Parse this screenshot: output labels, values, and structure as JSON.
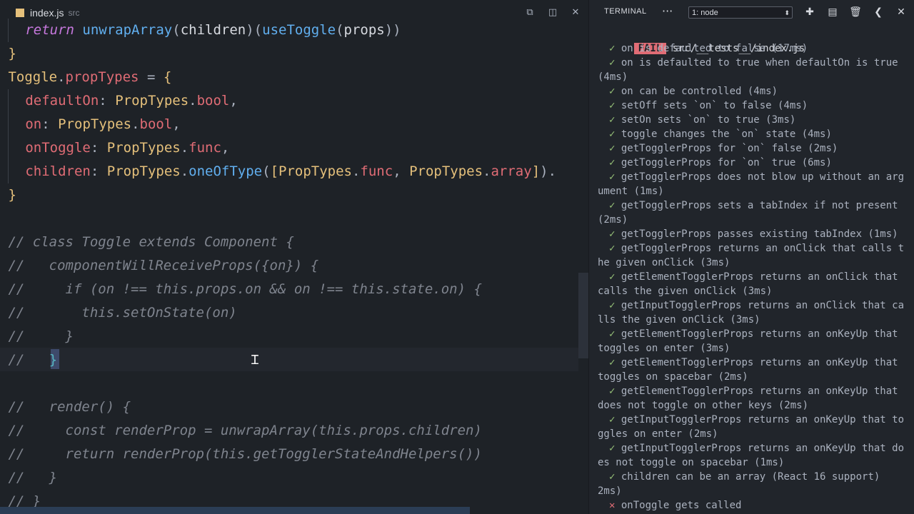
{
  "editor": {
    "tab": {
      "filename": "index.js",
      "path": "src"
    },
    "actions": [
      "open-preview",
      "split-editor",
      "close"
    ],
    "lines": [
      [
        {
          "c": "kw",
          "t": "return "
        },
        {
          "c": "fn",
          "t": "unwrapArray"
        },
        {
          "c": "pl",
          "t": "("
        },
        {
          "c": "tx",
          "t": "children"
        },
        {
          "c": "pl",
          "t": ")("
        },
        {
          "c": "fn",
          "t": "useToggle"
        },
        {
          "c": "pl",
          "t": "("
        },
        {
          "c": "tx",
          "t": "props"
        },
        {
          "c": "pl",
          "t": "))"
        }
      ],
      [
        {
          "c": "br",
          "t": "}"
        }
      ],
      [
        {
          "c": "cl",
          "t": "Toggle"
        },
        {
          "c": "pl",
          "t": "."
        },
        {
          "c": "pr",
          "t": "propTypes"
        },
        {
          "c": "pl",
          "t": " = "
        },
        {
          "c": "br",
          "t": "{"
        }
      ],
      [
        {
          "c": "pr",
          "t": "defaultOn"
        },
        {
          "c": "pl",
          "t": ": "
        },
        {
          "c": "cl",
          "t": "PropTypes"
        },
        {
          "c": "pl",
          "t": "."
        },
        {
          "c": "pr",
          "t": "bool"
        },
        {
          "c": "pl",
          "t": ","
        }
      ],
      [
        {
          "c": "pr",
          "t": "on"
        },
        {
          "c": "pl",
          "t": ": "
        },
        {
          "c": "cl",
          "t": "PropTypes"
        },
        {
          "c": "pl",
          "t": "."
        },
        {
          "c": "pr",
          "t": "bool"
        },
        {
          "c": "pl",
          "t": ","
        }
      ],
      [
        {
          "c": "pr",
          "t": "onToggle"
        },
        {
          "c": "pl",
          "t": ": "
        },
        {
          "c": "cl",
          "t": "PropTypes"
        },
        {
          "c": "pl",
          "t": "."
        },
        {
          "c": "pr",
          "t": "func"
        },
        {
          "c": "pl",
          "t": ","
        }
      ],
      [
        {
          "c": "pr",
          "t": "children"
        },
        {
          "c": "pl",
          "t": ": "
        },
        {
          "c": "cl",
          "t": "PropTypes"
        },
        {
          "c": "pl",
          "t": "."
        },
        {
          "c": "fn",
          "t": "oneOfType"
        },
        {
          "c": "pl",
          "t": "("
        },
        {
          "c": "br",
          "t": "["
        },
        {
          "c": "cl",
          "t": "PropTypes"
        },
        {
          "c": "pl",
          "t": "."
        },
        {
          "c": "pr",
          "t": "func"
        },
        {
          "c": "pl",
          "t": ", "
        },
        {
          "c": "cl",
          "t": "PropTypes"
        },
        {
          "c": "pl",
          "t": "."
        },
        {
          "c": "pr",
          "t": "array"
        },
        {
          "c": "br",
          "t": "]"
        },
        {
          "c": "pl",
          "t": ")."
        }
      ],
      [
        {
          "c": "br",
          "t": "}"
        }
      ],
      [],
      [
        {
          "c": "cm",
          "t": "// class Toggle extends Component {"
        }
      ],
      [
        {
          "c": "cm",
          "t": "//   componentWillReceiveProps({on}) {"
        }
      ],
      [
        {
          "c": "cm",
          "t": "//     if (on !== this.props.on && on !== this.state.on) {"
        }
      ],
      [
        {
          "c": "cm",
          "t": "//       this.setOnState(on)"
        }
      ],
      [
        {
          "c": "cm",
          "t": "//     }"
        }
      ],
      [
        {
          "c": "cm",
          "t": "//   "
        },
        {
          "c": "br-pair",
          "t": "}"
        }
      ],
      [],
      [
        {
          "c": "cm",
          "t": "//   render() {"
        }
      ],
      [
        {
          "c": "cm",
          "t": "//     const renderProp = unwrapArray(this.props.children)"
        }
      ],
      [
        {
          "c": "cm",
          "t": "//     return renderProp(this.getTogglerStateAndHelpers())"
        }
      ],
      [
        {
          "c": "cm",
          "t": "//   }"
        }
      ],
      [
        {
          "c": "cm",
          "t": "// }"
        }
      ]
    ]
  },
  "terminal": {
    "title": "TERMINAL",
    "more_label": "···",
    "selected_shell": "1: node",
    "fail_label": "FAIL",
    "fail_path": "src/__tests__/index.js",
    "lines": [
      {
        "m": "✓",
        "t": " on is defaulted to false (17ms)"
      },
      {
        "m": "✓",
        "t": " on is defaulted to true when defaultOn is true"
      },
      {
        "m": "",
        "t": "(4ms)",
        "wrap": true
      },
      {
        "m": "✓",
        "t": " on can be controlled (4ms)"
      },
      {
        "m": "✓",
        "t": " setOff sets `on` to false (4ms)"
      },
      {
        "m": "✓",
        "t": " setOn sets `on` to true (3ms)"
      },
      {
        "m": "✓",
        "t": " toggle changes the `on` state (4ms)"
      },
      {
        "m": "✓",
        "t": " getTogglerProps for `on` false (2ms)"
      },
      {
        "m": "✓",
        "t": " getTogglerProps for `on` true (6ms)"
      },
      {
        "m": "✓",
        "t": " getTogglerProps does not blow up without an arg"
      },
      {
        "m": "",
        "t": "ument (1ms)",
        "wrap": true
      },
      {
        "m": "✓",
        "t": " getTogglerProps sets a tabIndex if not present"
      },
      {
        "m": "",
        "t": "(2ms)",
        "wrap": true
      },
      {
        "m": "✓",
        "t": " getTogglerProps passes existing tabIndex (1ms)"
      },
      {
        "m": "✓",
        "t": " getTogglerProps returns an onClick that calls t"
      },
      {
        "m": "",
        "t": "he given onClick (3ms)",
        "wrap": true
      },
      {
        "m": "✓",
        "t": " getElementTogglerProps returns an onClick that"
      },
      {
        "m": "",
        "t": "calls the given onClick (3ms)",
        "wrap": true
      },
      {
        "m": "✓",
        "t": " getInputTogglerProps returns an onClick that ca"
      },
      {
        "m": "",
        "t": "lls the given onClick (3ms)",
        "wrap": true
      },
      {
        "m": "✓",
        "t": " getElementTogglerProps returns an onKeyUp that"
      },
      {
        "m": "",
        "t": "toggles on enter (3ms)",
        "wrap": true
      },
      {
        "m": "✓",
        "t": " getElementTogglerProps returns an onKeyUp that"
      },
      {
        "m": "",
        "t": "toggles on spacebar (2ms)",
        "wrap": true
      },
      {
        "m": "✓",
        "t": " getElementTogglerProps returns an onKeyUp that"
      },
      {
        "m": "",
        "t": "does not toggle on other keys (2ms)",
        "wrap": true
      },
      {
        "m": "✓",
        "t": " getInputTogglerProps returns an onKeyUp that to"
      },
      {
        "m": "",
        "t": "ggles on enter (2ms)",
        "wrap": true
      },
      {
        "m": "✓",
        "t": " getInputTogglerProps returns an onKeyUp that do"
      },
      {
        "m": "",
        "t": "es not toggle on spacebar (1ms)",
        "wrap": true
      },
      {
        "m": "✓",
        "t": " children can be an array (React 16 support)"
      },
      {
        "m": "",
        "t": "2ms)",
        "wrap": true
      },
      {
        "m": "✕",
        "t": " onToggle gets called"
      }
    ]
  },
  "colors": {
    "fail": "#e06c75",
    "pass": "#98c379",
    "accent": "#61afef"
  }
}
